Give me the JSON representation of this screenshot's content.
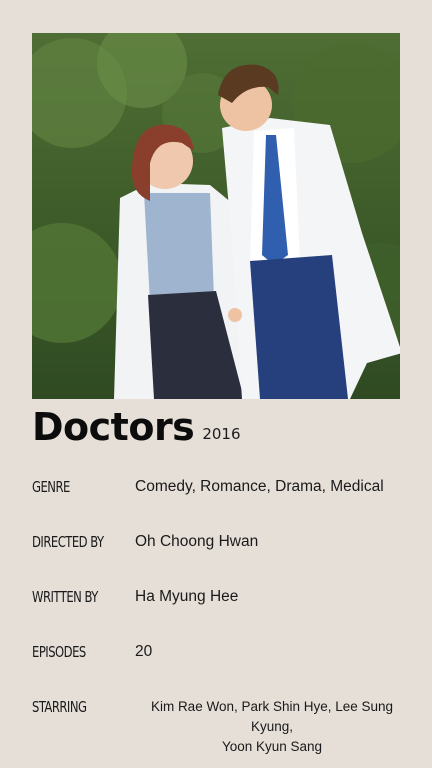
{
  "poster": {
    "photo": "two-doctors-photo",
    "title": "Doctors",
    "year": "2016"
  },
  "info": {
    "genre_label": "GENRE",
    "genre_value": "Comedy, Romance, Drama, Medical",
    "directed_label": "DIRECTED BY",
    "directed_value": "Oh Choong Hwan",
    "written_label": "WRITTEN BY",
    "written_value": "Ha Myung Hee",
    "episodes_label": "EPISODES",
    "episodes_value": "20",
    "starring_label": "STARRING",
    "starring_value_line1": "Kim Rae Won, Park Shin Hye, Lee Sung Kyung,",
    "starring_value_line2": "Yoon Kyun Sang"
  },
  "colors": {
    "background": "#e6dfd8",
    "text": "#111111"
  }
}
